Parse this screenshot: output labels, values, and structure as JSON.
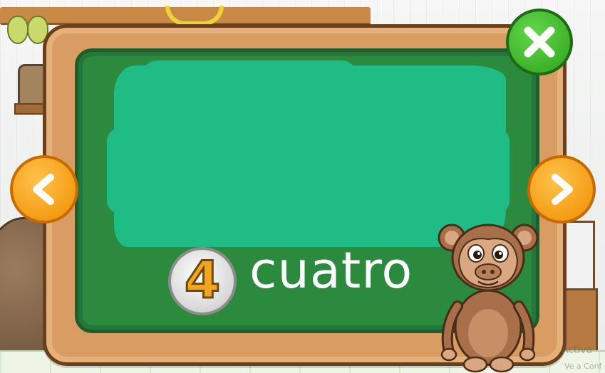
{
  "lesson": {
    "number": "4",
    "word": "cuatro"
  },
  "controls": {
    "close_icon": "close-x-icon",
    "prev_icon": "chevron-left-icon",
    "next_icon": "chevron-right-icon"
  },
  "colors": {
    "board": "#2b8a3e",
    "chalk": "#1fbc86",
    "frame": "#d99c62",
    "close_button": "#3fbe2b",
    "nav_button": "#f7a21b",
    "number_fill": "#f3a51c"
  },
  "watermark": {
    "line1": "Activa",
    "line2": "Ve a Conf"
  }
}
